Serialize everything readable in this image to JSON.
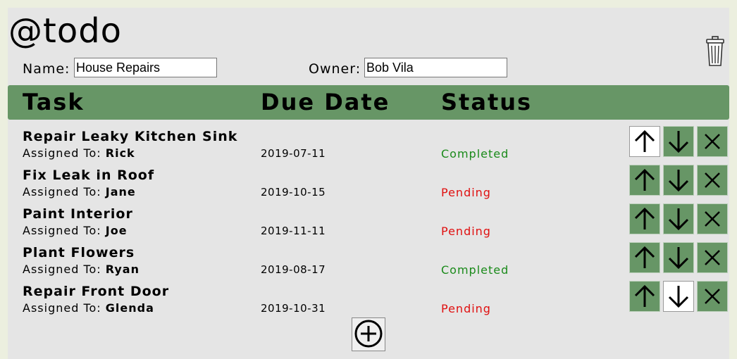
{
  "app": {
    "title": "@todo"
  },
  "form": {
    "name_label": "Name:",
    "name_value": "House Repairs",
    "owner_label": "Owner:",
    "owner_value": "Bob Vila"
  },
  "table": {
    "headers": {
      "task": "Task",
      "due": "Due Date",
      "status": "Status"
    },
    "assigned_prefix": "Assigned To: ",
    "rows": [
      {
        "task": "Repair Leaky Kitchen Sink",
        "assignee": "Rick",
        "due": "2019-07-11",
        "status": "Completed"
      },
      {
        "task": "Fix Leak in Roof",
        "assignee": "Jane",
        "due": "2019-10-15",
        "status": "Pending"
      },
      {
        "task": "Paint Interior",
        "assignee": "Joe",
        "due": "2019-11-11",
        "status": "Pending"
      },
      {
        "task": "Plant Flowers",
        "assignee": "Ryan",
        "due": "2019-08-17",
        "status": "Completed"
      },
      {
        "task": "Repair Front Door",
        "assignee": "Glenda",
        "due": "2019-10-31",
        "status": "Pending"
      }
    ]
  },
  "colors": {
    "accent": "#679666",
    "completed": "#1a8a1a",
    "pending": "#e01010"
  },
  "icons": {
    "delete_list": "trash-can-icon",
    "move_up": "arrow-up-icon",
    "move_down": "arrow-down-icon",
    "remove": "x-icon",
    "add": "plus-circle-icon"
  }
}
